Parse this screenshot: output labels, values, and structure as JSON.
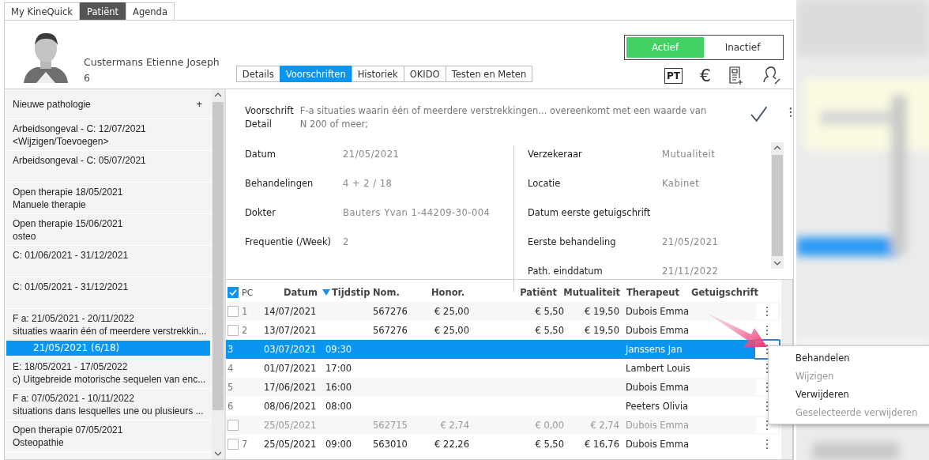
{
  "top_tabs": [
    {
      "label": "My KineQuick",
      "selected": false
    },
    {
      "label": "Patiënt",
      "selected": true
    },
    {
      "label": "Agenda",
      "selected": false
    }
  ],
  "patient": {
    "name": "Custermans Etienne Joseph",
    "number": "6"
  },
  "sub_tabs": [
    {
      "label": "Details",
      "selected": false
    },
    {
      "label": "Voorschriften",
      "selected": true
    },
    {
      "label": "Historiek",
      "selected": false
    },
    {
      "label": "OKIDO",
      "selected": false
    },
    {
      "label": "Testen en Meten",
      "selected": false
    }
  ],
  "status_toggle": [
    {
      "label": "Actief",
      "selected": true
    },
    {
      "label": "Inactief",
      "selected": false
    }
  ],
  "header_icons": {
    "pt": "PT",
    "euro": "€"
  },
  "sidebar": {
    "new_item": {
      "label": "Nieuwe pathologie",
      "plus": "+"
    },
    "items": [
      {
        "line1": "Arbeidsongeval - C: 12/07/2021",
        "line2": "<Wijzigen/Toevoegen>",
        "selected": false
      },
      {
        "line1": "Arbeidsongeval - C: 05/07/2021",
        "selected": false
      },
      {
        "line1": "Open therapie 18/05/2021",
        "line2": "Manuele therapie",
        "selected": false
      },
      {
        "line1": "Open therapie 15/06/2021",
        "line2": "osteo",
        "selected": false
      },
      {
        "line1": "C: 01/06/2021 - 31/12/2021",
        "selected": false
      },
      {
        "line1": "C: 01/05/2021 - 31/12/2021",
        "selected": false
      },
      {
        "line1": "F a: 21/05/2021 - 20/11/2022",
        "line2": "situaties waarin één of meerdere verstrekkin...",
        "selected": false,
        "children": [
          {
            "label": "21/05/2021  (6/18)",
            "selected": true
          }
        ]
      },
      {
        "line1": "E: 18/05/2021 - 17/05/2022",
        "line2": "c) Uitgebreide motorische sequelen van enc...",
        "selected": false
      },
      {
        "line1": "F a: 07/05/2021 - 10/11/2022",
        "line2": "situations dans lesquelles une ou plusieurs ...",
        "selected": false
      },
      {
        "line1": "Open therapie 07/05/2021",
        "line2": "Osteopathie",
        "selected": false
      }
    ]
  },
  "prescription": {
    "voorschrift_label": "Voorschrift",
    "detail_label": "Detail",
    "voorschrift": "F-a situaties waarin één of meerdere verstrekkingen... overeenkomt met een waarde van",
    "detail": "N 200 of meer;",
    "left_fields": [
      {
        "label": "Datum",
        "value": "21/05/2021"
      },
      {
        "label": "Behandelingen",
        "value": "4 + 2 / 18"
      },
      {
        "label": "Dokter",
        "value": "Bauters Yvan 1-44209-30-004"
      },
      {
        "label": "Frequentie (/Week)",
        "value": "2"
      }
    ],
    "right_fields": [
      {
        "label": "Verzekeraar",
        "value": "Mutualiteit"
      },
      {
        "label": "Locatie",
        "value": "Kabinet"
      },
      {
        "label": "Datum eerste getuigschrift"
      },
      {
        "label": "Eerste behandeling",
        "value": "21/05/2021"
      },
      {
        "label": "Path. einddatum",
        "value": "21/11/2022"
      }
    ]
  },
  "table": {
    "select_all": {
      "checked": true
    },
    "columns": [
      {
        "label": "PC",
        "sorted": false
      },
      {
        "label": "Datum",
        "sorted": true
      },
      {
        "label": "Tijdstip",
        "sorted": false
      },
      {
        "label": "Nom.",
        "sorted": false
      },
      {
        "label": "Honor.",
        "sorted": false
      },
      {
        "label": "Patiënt",
        "sorted": false
      },
      {
        "label": "Mutualiteit",
        "sorted": false
      },
      {
        "label": "Therapeut",
        "sorted": false
      },
      {
        "label": "Getuigschrift",
        "sorted": false
      }
    ],
    "rows": [
      {
        "kind": "billed",
        "checked": false,
        "pc": "1",
        "datum": "14/07/2021",
        "nom": "567276",
        "honor": "€ 25,00",
        "patient": "€ 5,50",
        "mutualiteit": "€ 19,50",
        "therapeut": "Dubois Emma",
        "selected": false,
        "disabled": false
      },
      {
        "kind": "billed",
        "checked": false,
        "pc": "2",
        "datum": "13/07/2021",
        "nom": "567276",
        "honor": "€ 25,00",
        "patient": "€ 5,50",
        "mutualiteit": "€ 19,50",
        "therapeut": "Dubois Emma",
        "selected": false,
        "disabled": false
      },
      {
        "kind": "planned",
        "pc": "3",
        "datum": "03/07/2021",
        "tijdstip": "09:30",
        "therapeut": "Janssens Jan",
        "selected": true,
        "disabled": false
      },
      {
        "kind": "planned",
        "pc": "4",
        "datum": "01/07/2021",
        "tijdstip": "17:00",
        "therapeut": "Lambert Louis",
        "selected": false,
        "disabled": false
      },
      {
        "kind": "planned",
        "pc": "5",
        "datum": "17/06/2021",
        "tijdstip": "16:00",
        "therapeut": "Dubois Emma",
        "selected": false,
        "disabled": false
      },
      {
        "kind": "planned",
        "pc": "6",
        "datum": "08/06/2021",
        "tijdstip": "08:00",
        "therapeut": "Peeters Olivia",
        "selected": false,
        "disabled": false
      },
      {
        "kind": "billed",
        "checked": false,
        "datum": "25/05/2021",
        "nom": "562715",
        "honor": "€ 2,74",
        "patient": "€ 0,00",
        "mutualiteit": "€ 2,74",
        "therapeut": "Dubois Emma",
        "selected": false,
        "disabled": true
      },
      {
        "kind": "billed",
        "checked": false,
        "pc": "7",
        "datum": "25/05/2021",
        "tijdstip": "09:00",
        "nom": "563010",
        "honor": "€ 22,26",
        "patient": "€ 5,50",
        "mutualiteit": "€ 16,76",
        "therapeut": "Dubois Emma",
        "selected": false,
        "disabled": false
      }
    ]
  },
  "context_menu": [
    {
      "label": "Behandelen",
      "disabled": false
    },
    {
      "label": "Wijzigen",
      "disabled": true
    },
    {
      "label": "Verwijderen",
      "disabled": false
    },
    {
      "label": "Geselecteerde verwijderen",
      "disabled": true
    }
  ]
}
